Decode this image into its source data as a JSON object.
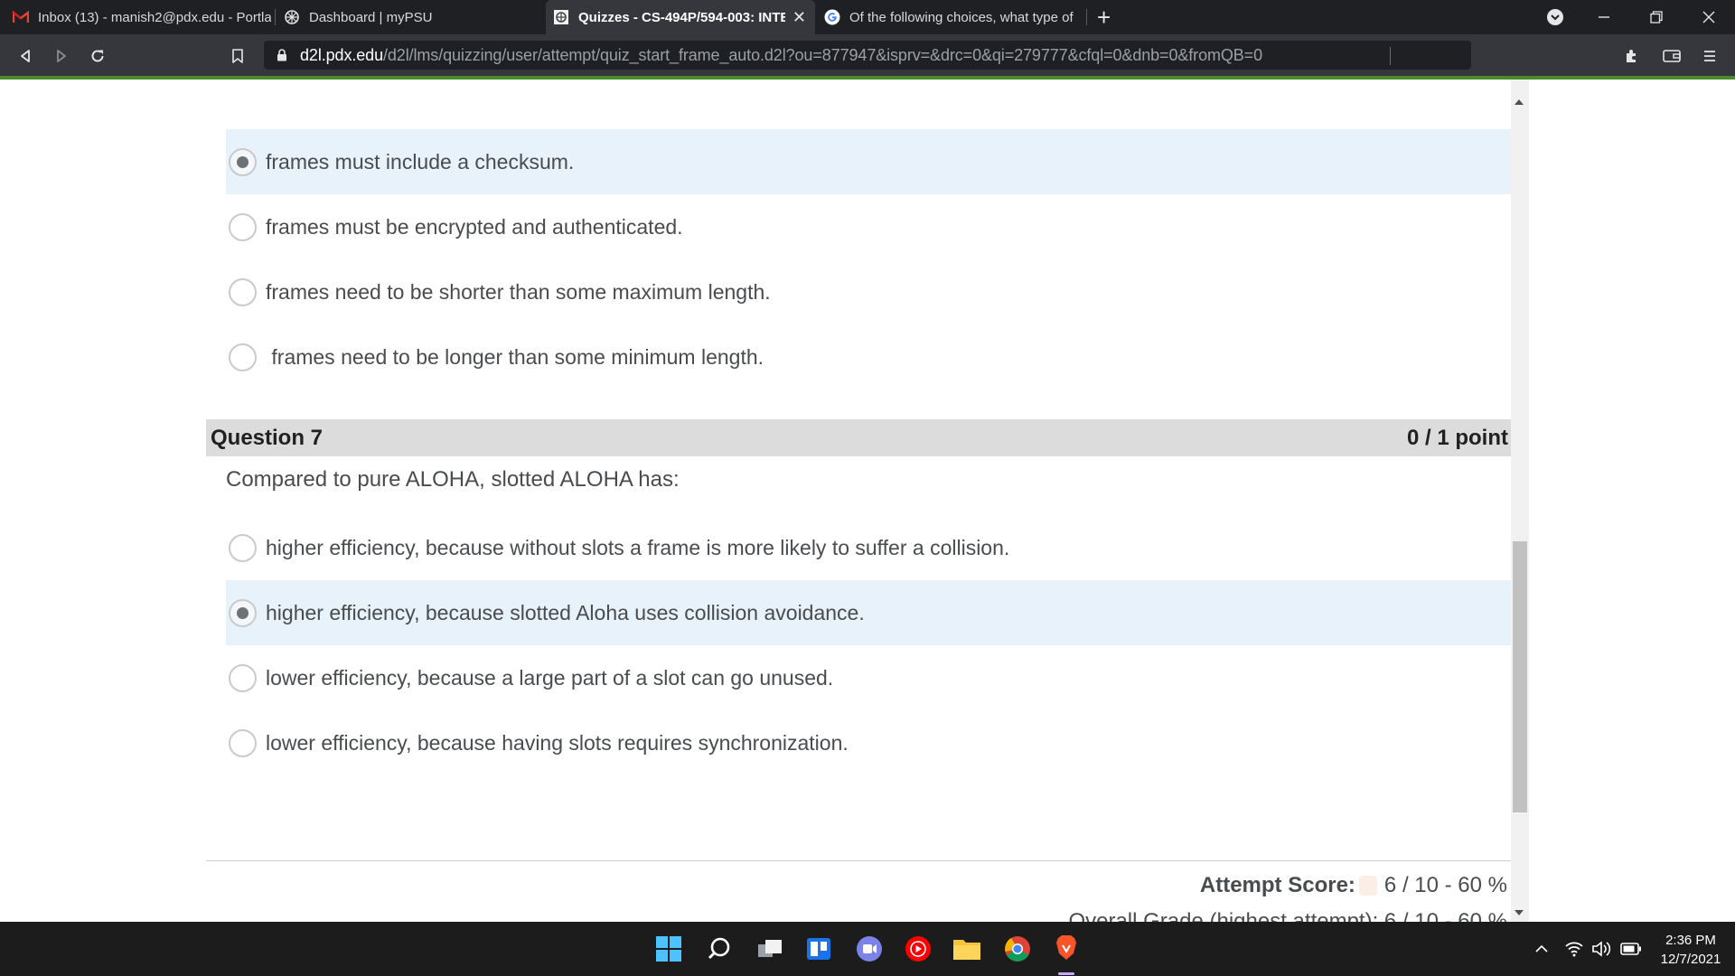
{
  "browser": {
    "tabs": [
      {
        "label": "Inbox (13) - manish2@pdx.edu - Portla",
        "icon": "gmail-icon",
        "active": false
      },
      {
        "label": "Dashboard | myPSU",
        "icon": "psu-icon",
        "active": false
      },
      {
        "label": "Quizzes - CS-494P/594-003: INTE",
        "icon": "d2l-icon",
        "active": true
      },
      {
        "label": "Of the following choices, what type of",
        "icon": "google-icon",
        "active": false
      }
    ],
    "url_host": "d2l.pdx.edu",
    "url_path": "/d2l/lms/quizzing/user/attempt/quiz_start_frame_auto.d2l?ou=877947&isprv=&drc=0&qi=279777&cfql=0&dnb=0&fromQB=0",
    "brave_badge": "1"
  },
  "question6": {
    "options": [
      {
        "label": "frames must include a checksum.",
        "selected": true
      },
      {
        "label": "frames must be encrypted and authenticated.",
        "selected": false
      },
      {
        "label": "frames need to be shorter than some maximum length.",
        "selected": false
      },
      {
        "label": " frames need to be longer than some minimum length.",
        "selected": false
      }
    ]
  },
  "question7": {
    "title": "Question 7",
    "points": "0 / 1 point",
    "text": "Compared to pure ALOHA, slotted ALOHA has:",
    "options": [
      {
        "label": "higher efficiency, because without slots a frame is more likely to suffer a collision.",
        "selected": false
      },
      {
        "label": "higher efficiency, because slotted Aloha uses collision avoidance.",
        "selected": true
      },
      {
        "label": "lower efficiency, because a large part of a slot can go unused.",
        "selected": false
      },
      {
        "label": "lower efficiency, because having slots requires synchronization.",
        "selected": false
      }
    ]
  },
  "score": {
    "attempt_label": "Attempt Score:",
    "attempt_value": "6 / 10 - 60 %",
    "overall_text": "Overall Grade (highest attempt):  6 / 10 - 60 %"
  },
  "taskbar": {
    "time": "2:36 PM",
    "date": "12/7/2021"
  },
  "colors": {
    "selected_bg": "#e8f2fb",
    "question_header_bg": "#dcdcdc",
    "brand_green": "#4a8b2c"
  }
}
